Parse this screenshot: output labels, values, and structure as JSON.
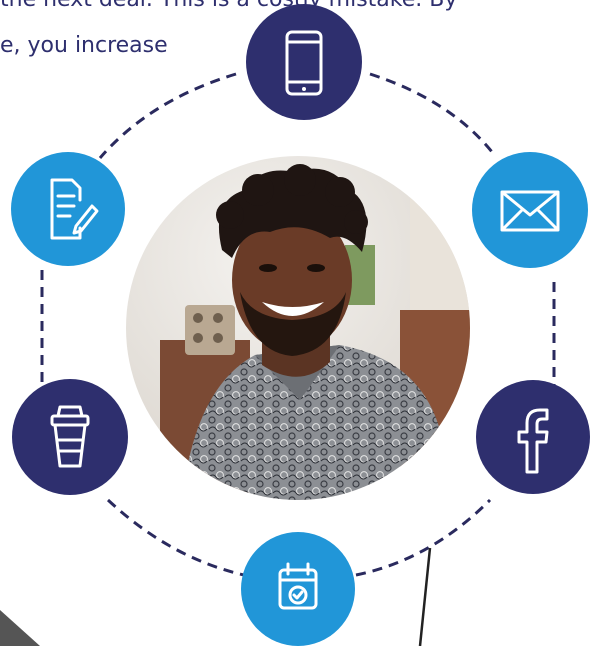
{
  "intro": {
    "line1": "the next deal. This is a costly mistake. By",
    "line2": "e, you increase"
  },
  "colors": {
    "navy": "#2e2f6e",
    "blue": "#2196d8",
    "dash": "#2a2a5e",
    "background": "#ffffff"
  },
  "icons": {
    "top": "phone-icon",
    "upper_left": "document-edit-icon",
    "upper_right": "envelope-icon",
    "lower_left": "coffee-cup-icon",
    "lower_right": "facebook-icon",
    "bottom": "calendar-check-icon"
  }
}
